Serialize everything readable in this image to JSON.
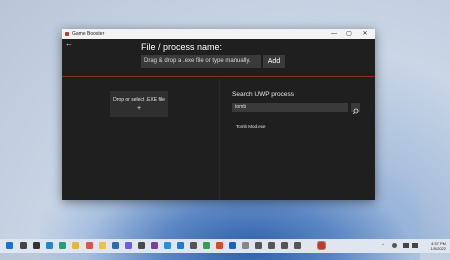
{
  "window": {
    "title": "Game Booster",
    "controls": {
      "minimize": "—",
      "maximize": "▢",
      "close": "✕"
    }
  },
  "header": {
    "back_icon": "←",
    "title": "File / process name:",
    "input_placeholder": "Drag & drop a .exe file or type manually.",
    "add_label": "Add"
  },
  "left_panel": {
    "drop_label": "Drop or select .EXE file",
    "plus": "+"
  },
  "right_panel": {
    "title": "Search UWP process",
    "search_value": "tomb",
    "results": [
      "Tomb Mod.exe"
    ]
  },
  "taskbar": {
    "icons": [
      {
        "name": "windows-start-icon",
        "color": "#1f6fd1"
      },
      {
        "name": "search-icon",
        "color": "#444444"
      },
      {
        "name": "task-view-icon",
        "color": "#333333"
      },
      {
        "name": "widgets-icon",
        "color": "#2a86c8"
      },
      {
        "name": "edge-icon",
        "color": "#1fa37a"
      },
      {
        "name": "chrome-icon",
        "color": "#e2b93b"
      },
      {
        "name": "mail-icon",
        "color": "#d9534f"
      },
      {
        "name": "explorer-icon",
        "color": "#f0c040"
      },
      {
        "name": "store-icon",
        "color": "#2b6cb0"
      },
      {
        "name": "teams-icon",
        "color": "#6c5ce7"
      },
      {
        "name": "notepad-icon",
        "color": "#4a4a4a"
      },
      {
        "name": "onenote-icon",
        "color": "#7b3fa0"
      },
      {
        "name": "photos-icon",
        "color": "#2b8fd6"
      },
      {
        "name": "vscode-icon",
        "color": "#1e7acb"
      },
      {
        "name": "settings-icon",
        "color": "#555555"
      },
      {
        "name": "maps-icon",
        "color": "#2aa44f"
      },
      {
        "name": "office-icon",
        "color": "#d84a2b"
      },
      {
        "name": "outlook-icon",
        "color": "#1565c0"
      },
      {
        "name": "calendar-icon",
        "color": "#888888"
      },
      {
        "name": "game-booster-icon",
        "color": "#c0392b"
      }
    ],
    "tray": {
      "chevron": "^",
      "time": "4:37 PM",
      "date": "1/5/2022"
    }
  }
}
